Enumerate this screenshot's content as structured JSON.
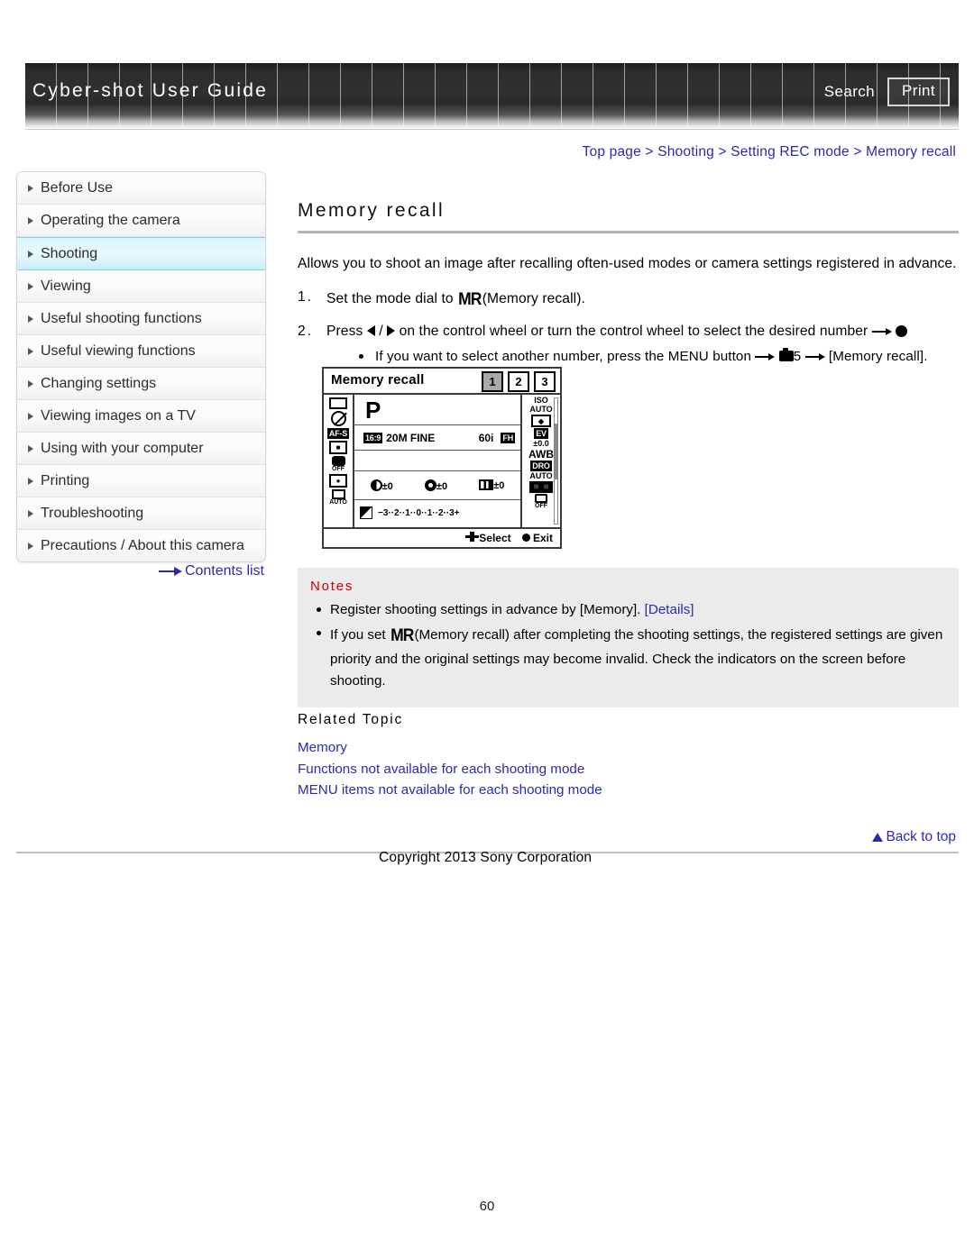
{
  "header": {
    "title": "Cyber-shot User Guide",
    "search_label": "Search",
    "print_label": "Print"
  },
  "breadcrumb": {
    "items": [
      "Top page",
      "Shooting",
      "Setting REC mode",
      "Memory recall"
    ],
    "text": "Top page > Shooting > Setting REC mode > Memory recall"
  },
  "sidebar": {
    "items": [
      {
        "label": "Before Use",
        "active": false
      },
      {
        "label": "Operating the camera",
        "active": false
      },
      {
        "label": "Shooting",
        "active": true
      },
      {
        "label": "Viewing",
        "active": false
      },
      {
        "label": "Useful shooting functions",
        "active": false
      },
      {
        "label": "Useful viewing functions",
        "active": false
      },
      {
        "label": "Changing settings",
        "active": false
      },
      {
        "label": "Viewing images on a TV",
        "active": false
      },
      {
        "label": "Using with your computer",
        "active": false
      },
      {
        "label": "Printing",
        "active": false
      },
      {
        "label": "Troubleshooting",
        "active": false
      },
      {
        "label": "Precautions / About this camera",
        "active": false
      }
    ],
    "contents_list_label": "Contents list"
  },
  "main": {
    "title": "Memory recall",
    "intro": "Allows you to shoot an image after recalling often-used modes or camera settings registered in advance.",
    "step1": {
      "number": "1.",
      "text_before": "Set the mode dial to",
      "glyph": "MR",
      "text_after": "(Memory recall)."
    },
    "step2": {
      "number": "2.",
      "text_before": "Press",
      "separator": "/",
      "text_middle": "on the control wheel or turn the control wheel to select the desired number",
      "substep": {
        "text_before": "If you want to select another number, press the MENU button",
        "menu_number": "5",
        "text_after": "[Memory recall]."
      }
    }
  },
  "lcd": {
    "title": "Memory recall",
    "tabs": [
      "1",
      "2",
      "3"
    ],
    "selected_tab": "1",
    "mode": "P",
    "aspect": "16:9",
    "image_size": "20M FINE",
    "movie_rate": "60i",
    "movie_quality": "FH",
    "left_icons": [
      "drive-mode-single-icon",
      "flash-off-icon",
      "af-s-icon",
      "focus-area-icon",
      "smile-off-icon",
      "face-detection-icon",
      "framing-auto-icon"
    ],
    "left_labels": {
      "af": "AF-S",
      "smile_off": "OFF",
      "framing": "AUTO"
    },
    "right_items": [
      {
        "label": "ISO",
        "sub": "AUTO"
      },
      {
        "label": "metering-icon",
        "sub": ""
      },
      {
        "label": "EV",
        "sub": "±0.0"
      },
      {
        "label": "AWB",
        "sub": ""
      },
      {
        "label": "DRO",
        "sub": "AUTO"
      },
      {
        "label": "SteadyShot",
        "sub": ""
      },
      {
        "label": "creative-style-off",
        "sub": "OFF"
      }
    ],
    "adjust_row": [
      {
        "icon": "contrast-icon",
        "value": "±0"
      },
      {
        "icon": "saturation-icon",
        "value": "±0"
      },
      {
        "icon": "sharpness-icon",
        "value": "±0"
      }
    ],
    "ev_scale": "−3··2··1··0··1··2··3+",
    "ev_marker": "0",
    "footer_select": "Select",
    "footer_exit": "Exit"
  },
  "notes": {
    "title": "Notes",
    "items": [
      {
        "text": "Register shooting settings in advance by [Memory].",
        "link": "[Details]"
      },
      {
        "text_before": "If you set",
        "glyph": "MR",
        "text_after": "(Memory recall) after completing the shooting settings, the registered settings are given priority and the original settings may become invalid. Check the indicators on the screen before shooting."
      }
    ]
  },
  "related": {
    "title": "Related Topic",
    "links": [
      "Memory",
      "Functions not available for each shooting mode",
      "MENU items not available for each shooting mode"
    ]
  },
  "footer": {
    "back_to_top": "Back to top",
    "copyright": "Copyright 2013 Sony Corporation",
    "page_number": "60"
  },
  "colors": {
    "link": "#2a2ab0",
    "notes_title": "#cc0000",
    "active_item": "#d9f4fb",
    "notes_bg": "#ebebeb"
  }
}
